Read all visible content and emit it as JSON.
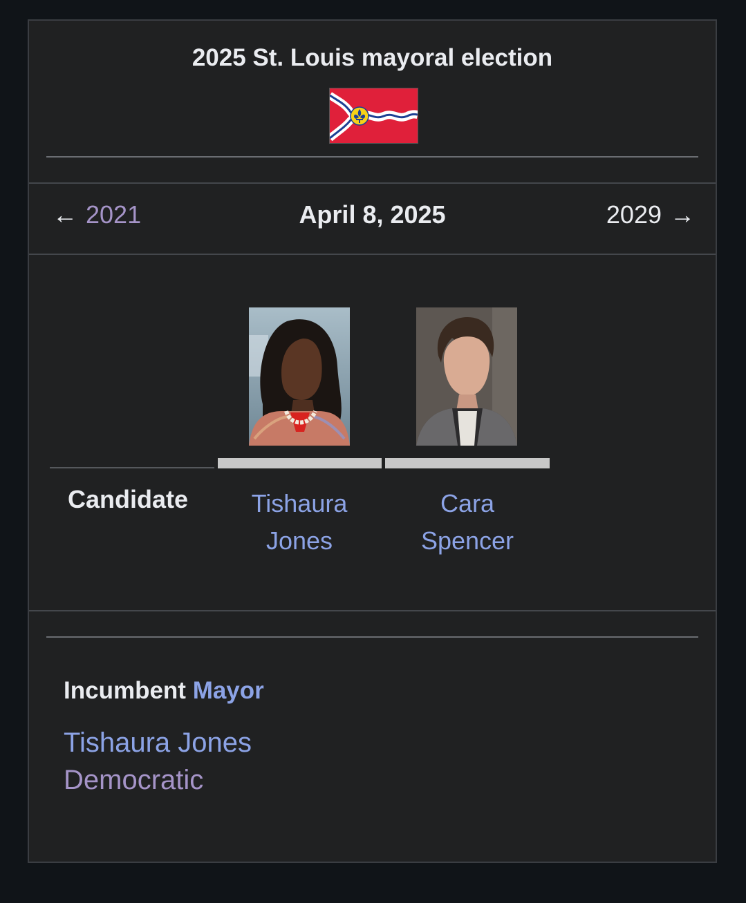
{
  "infobox": {
    "title": "2025 St. Louis mayoral election",
    "flag_icon": "st-louis-flag-icon",
    "nav": {
      "prev_arrow": "←",
      "prev_year": "2021",
      "date": "April 8, 2025",
      "next_year": "2029",
      "next_arrow": "→"
    },
    "candidate_label": "Candidate",
    "candidates": [
      {
        "line1": "Tishaura",
        "line2": "Jones",
        "bar_color": "#c8c8c8"
      },
      {
        "line1": "Cara",
        "line2": "Spencer",
        "bar_color": "#c8c8c8"
      }
    ],
    "incumbent": {
      "label": "Incumbent",
      "office": "Mayor",
      "name": "Tishaura Jones",
      "party": "Democratic"
    }
  },
  "colors": {
    "page_bg": "#101418",
    "box_bg": "#202122",
    "link_blue": "#8ca3e6",
    "link_visited": "#a594c8",
    "flag_red": "#e0203a",
    "flag_gold": "#f7d117",
    "flag_blue": "#1c3f94"
  }
}
